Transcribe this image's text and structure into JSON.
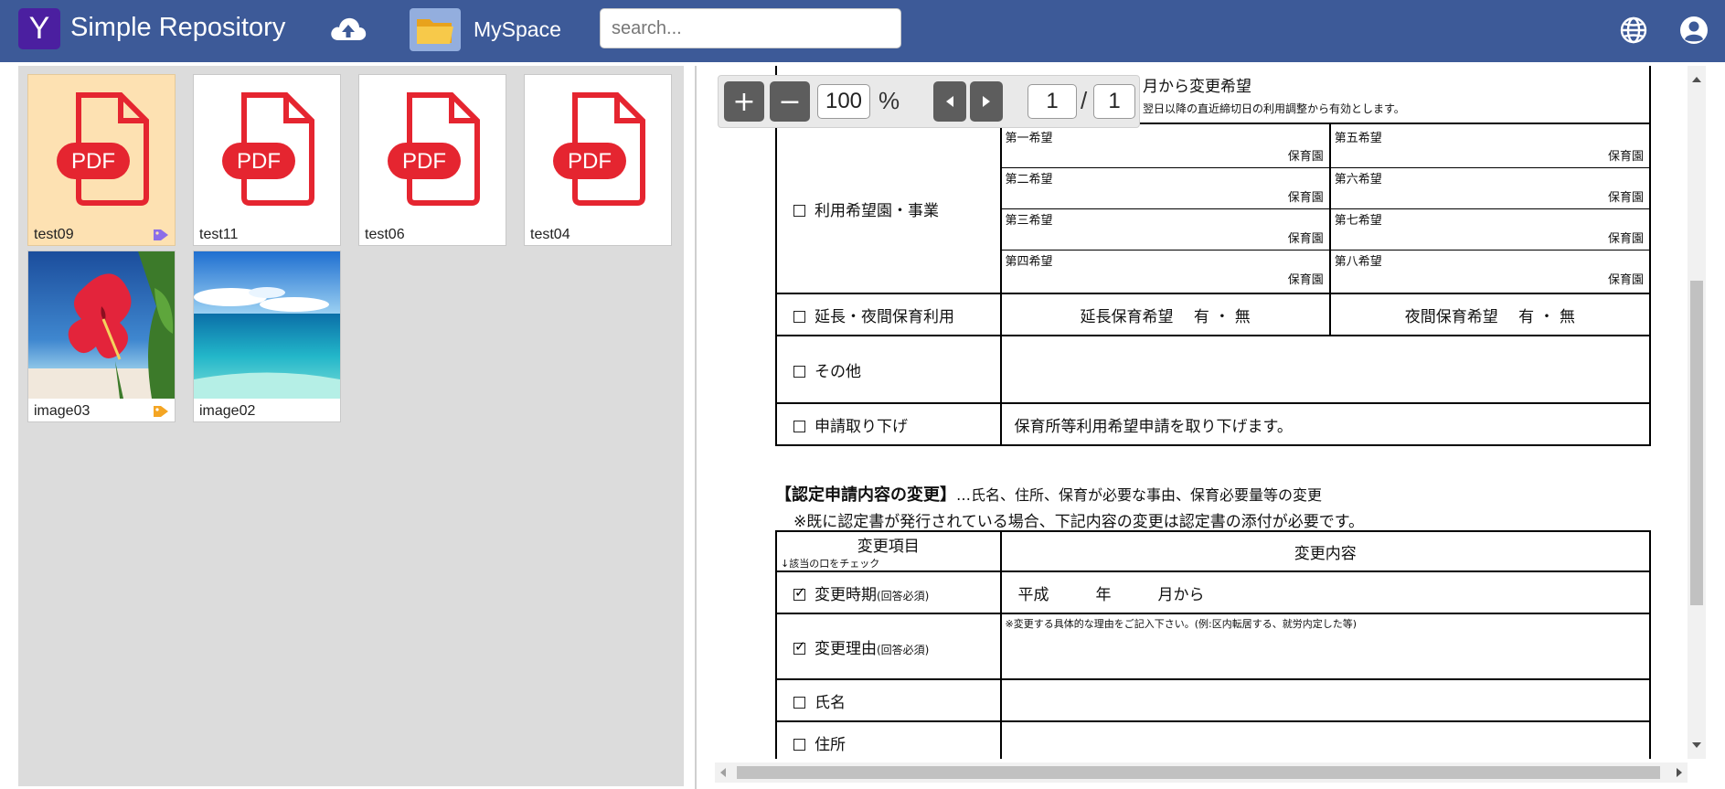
{
  "header": {
    "logo_letter": "Y",
    "app_title": "Simple Repository",
    "upload_icon": "cloud-upload-icon",
    "myspace_label": "MySpace",
    "search_placeholder": "search...",
    "globe_icon": "globe-icon",
    "account_icon": "account-icon",
    "bar_color": "#3d5a98",
    "logo_color": "#4b1fa0"
  },
  "files": [
    {
      "name": "test09",
      "type": "pdf",
      "selected": true,
      "tag_color": "#8c6ee8"
    },
    {
      "name": "test11",
      "type": "pdf"
    },
    {
      "name": "test06",
      "type": "pdf"
    },
    {
      "name": "test04",
      "type": "pdf"
    },
    {
      "name": "image03",
      "type": "image",
      "tag_color": "#f4a523"
    },
    {
      "name": "image02",
      "type": "image"
    }
  ],
  "pdf_badge": "PDF",
  "toolbar": {
    "zoom_in": "+",
    "zoom_out": "−",
    "zoom_value": "100",
    "zoom_unit": "%",
    "page_current": "1",
    "page_sep": "/",
    "page_total": "1"
  },
  "document": {
    "top_line": "月から変更希望",
    "top_note": "翌日以降の直近締切日の利用調整から有効とします。",
    "row_facility": "利用希望園・事業",
    "wishes_left": [
      "第一希望",
      "第二希望",
      "第三希望",
      "第四希望"
    ],
    "wishes_right": [
      "第五希望",
      "第六希望",
      "第七希望",
      "第八希望"
    ],
    "wish_suffix": "保育園",
    "row_extend": "延長・夜間保育利用",
    "extend_left": "延長保育希望　 有 ・ 無",
    "extend_right": "夜間保育希望　 有 ・ 無",
    "row_other": "その他",
    "row_withdraw": "申請取り下げ",
    "withdraw_text": "保育所等利用希望申請を取り下げます。",
    "section_title": "【認定申請内容の変更】",
    "section_title_rest": "…氏名、住所、保育が必要な事由、保育必要量等の変更",
    "section_note": "※既に認定書が発行されている場合、下記内容の変更は認定書の添付が必要です。",
    "col_item": "変更項目",
    "col_item_sub": "↓該当の口をチェック",
    "col_content": "変更内容",
    "row_time": "変更時期",
    "row_time_sub": "(回答必須)",
    "time_text": "平成　　　年　　　月から",
    "row_reason": "変更理由",
    "row_reason_sub": "(回答必須)",
    "reason_note": "※変更する具体的な理由をご記入下さい。(例:区内転居する、就労内定した等)",
    "row_name": "氏名",
    "row_address": "住所"
  }
}
